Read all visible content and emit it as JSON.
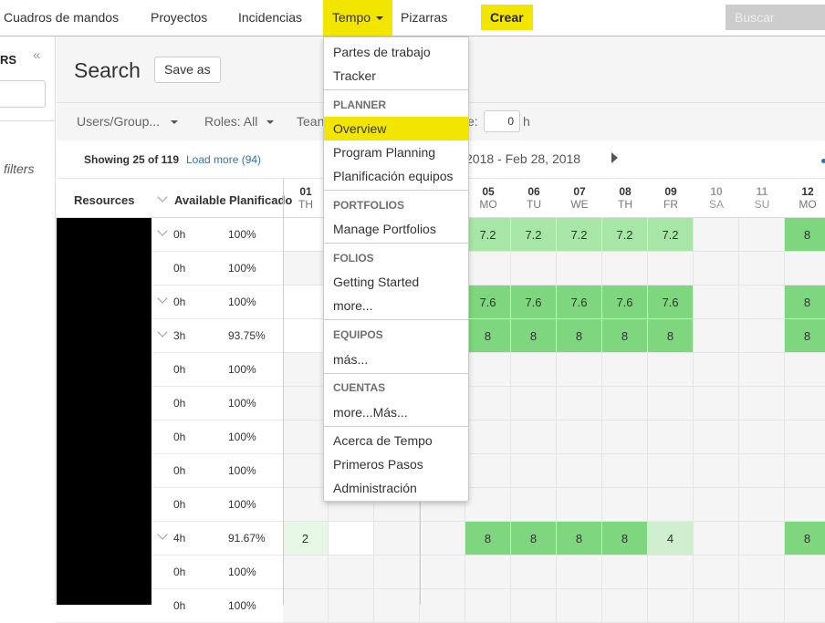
{
  "nav": {
    "items": [
      "Cuadros de mandos",
      "Proyectos",
      "Incidencias",
      "Tempo",
      "Pizarras"
    ],
    "crear": "Crear",
    "search_placeholder": "Buscar",
    "accent": "#f2e600"
  },
  "sidebar": {
    "title": "RS",
    "filters_text": "filters"
  },
  "main": {
    "title": "Search",
    "save_as": "Save as",
    "filters": {
      "users": "Users/Group...",
      "roles": "Roles: All",
      "team": "Tean",
      "hours_label": "e:",
      "hours_value": "0",
      "hours_unit": "h"
    },
    "showing": "Showing 25 of 119",
    "load_more": "Load more (94)",
    "date_range": "2018 - Feb 28, 2018",
    "columns": {
      "resources": "Resources",
      "available": "Available",
      "planned": "Planificado"
    },
    "days": [
      {
        "n": "01",
        "w": "TH",
        "weekend": false
      },
      {
        "n": "",
        "w": "",
        "weekend": false
      },
      {
        "n": "",
        "w": "",
        "weekend": false
      },
      {
        "n": "",
        "w": "",
        "weekend": false
      },
      {
        "n": "05",
        "w": "MO",
        "weekend": false
      },
      {
        "n": "06",
        "w": "TU",
        "weekend": false
      },
      {
        "n": "07",
        "w": "WE",
        "weekend": false
      },
      {
        "n": "08",
        "w": "TH",
        "weekend": false
      },
      {
        "n": "09",
        "w": "FR",
        "weekend": false
      },
      {
        "n": "10",
        "w": "SA",
        "weekend": true
      },
      {
        "n": "11",
        "w": "SU",
        "weekend": true
      },
      {
        "n": "12",
        "w": "MO",
        "weekend": false
      }
    ],
    "rows": [
      {
        "avail": "0h",
        "pct": "100%",
        "chev": true,
        "cells": [
          "w",
          "",
          "",
          "",
          "7.2",
          "7.2",
          "7.2",
          "7.2",
          "7.2",
          "",
          "",
          "8"
        ]
      },
      {
        "avail": "0h",
        "pct": "100%",
        "chev": false,
        "cells": [
          "",
          "",
          "",
          "",
          "",
          "",
          "",
          "",
          "",
          "",
          "",
          ""
        ]
      },
      {
        "avail": "0h",
        "pct": "100%",
        "chev": true,
        "cells": [
          "w",
          "",
          "",
          "",
          "7.6",
          "7.6",
          "7.6",
          "7.6",
          "7.6",
          "",
          "",
          "8"
        ]
      },
      {
        "avail": "3h",
        "pct": "93.75%",
        "chev": true,
        "cells": [
          "w",
          "",
          "",
          "",
          "8",
          "8",
          "8",
          "8",
          "8",
          "",
          "",
          "8"
        ]
      },
      {
        "avail": "0h",
        "pct": "100%",
        "chev": false,
        "cells": [
          "",
          "",
          "",
          "",
          "",
          "",
          "",
          "",
          "",
          "",
          "",
          ""
        ]
      },
      {
        "avail": "0h",
        "pct": "100%",
        "chev": false,
        "cells": [
          "",
          "",
          "",
          "",
          "",
          "",
          "",
          "",
          "",
          "",
          "",
          ""
        ]
      },
      {
        "avail": "0h",
        "pct": "100%",
        "chev": false,
        "cells": [
          "",
          "",
          "",
          "",
          "",
          "",
          "",
          "",
          "",
          "",
          "",
          ""
        ]
      },
      {
        "avail": "0h",
        "pct": "100%",
        "chev": false,
        "cells": [
          "",
          "",
          "",
          "",
          "",
          "",
          "",
          "",
          "",
          "",
          "",
          ""
        ]
      },
      {
        "avail": "0h",
        "pct": "100%",
        "chev": false,
        "cells": [
          "",
          "",
          "",
          "",
          "",
          "",
          "",
          "",
          "",
          "",
          "",
          ""
        ]
      },
      {
        "avail": "4h",
        "pct": "91.67%",
        "chev": true,
        "cells": [
          "2",
          "w",
          "",
          "",
          "8",
          "8",
          "8",
          "8",
          "4",
          "",
          "",
          "8"
        ]
      },
      {
        "avail": "0h",
        "pct": "100%",
        "chev": false,
        "cells": [
          "",
          "",
          "",
          "",
          "",
          "",
          "",
          "",
          "",
          "",
          "",
          ""
        ]
      },
      {
        "avail": "0h",
        "pct": "100%",
        "chev": false,
        "cells": [
          "",
          "",
          "",
          "",
          "",
          "",
          "",
          "",
          "",
          "",
          "",
          ""
        ]
      }
    ]
  },
  "tempo_menu": {
    "group1": [
      "Partes de trabajo",
      "Tracker"
    ],
    "planner_header": "PLANNER",
    "planner": [
      "Overview",
      "Program Planning",
      "Planificación equipos"
    ],
    "portfolios_header": "PORTFOLIOS",
    "portfolios": [
      "Manage Portfolios"
    ],
    "folios_header": "FOLIOS",
    "folios": [
      "Getting Started",
      "more..."
    ],
    "equipos_header": "EQUIPOS",
    "equipos": [
      "más..."
    ],
    "cuentas_header": "CUENTAS",
    "cuentas": [
      "more...Más..."
    ],
    "footer": [
      "Acerca de Tempo",
      "Primeros Pasos",
      "Administración"
    ]
  }
}
